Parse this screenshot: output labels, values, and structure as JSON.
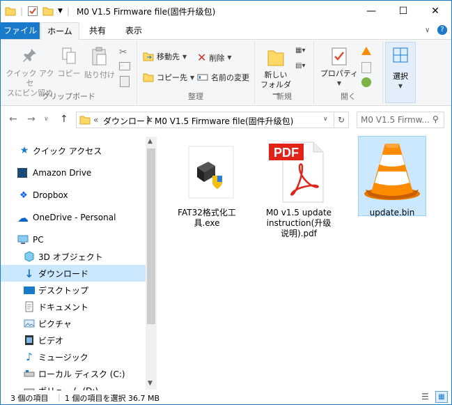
{
  "window": {
    "title": "M0 V1.5 Firmware file(固件升级包)"
  },
  "ribbon_tabs": [
    "ファイル",
    "ホーム",
    "共有",
    "表示"
  ],
  "ribbon": {
    "clipboard": {
      "pin_label": "クイック アクセ\nスにピン留め",
      "copy_label": "コピー",
      "paste_label": "貼り付け",
      "group_label": "クリップボード"
    },
    "organize": {
      "move_to": "移動先",
      "copy_to": "コピー先",
      "delete": "削除",
      "rename": "名前の変更",
      "group_label": "整理"
    },
    "new": {
      "new_folder": "新しい\nフォルダー",
      "group_label": "新規"
    },
    "open": {
      "properties": "プロパティ",
      "group_label": "開く"
    },
    "select": {
      "select": "選択"
    }
  },
  "address": {
    "overflow": "«",
    "crumbs": [
      "ダウンロード",
      "M0 V1.5 Firmware file(固件升级包)"
    ],
    "search_placeholder": "M0 V1.5 Firmw..."
  },
  "nav": [
    {
      "label": "クイック アクセス",
      "icon": "star-icon"
    },
    {
      "label": "Amazon Drive",
      "icon": "amazon-drive-icon"
    },
    {
      "label": "Dropbox",
      "icon": "dropbox-icon"
    },
    {
      "label": "OneDrive - Personal",
      "icon": "onedrive-icon"
    },
    {
      "label": "PC",
      "icon": "pc-icon"
    },
    {
      "label": "3D オブジェクト",
      "icon": "3d-objects-icon"
    },
    {
      "label": "ダウンロード",
      "icon": "download-icon",
      "selected": true
    },
    {
      "label": "デスクトップ",
      "icon": "desktop-icon"
    },
    {
      "label": "ドキュメント",
      "icon": "documents-icon"
    },
    {
      "label": "ピクチャ",
      "icon": "pictures-icon"
    },
    {
      "label": "ビデオ",
      "icon": "videos-icon"
    },
    {
      "label": "ミュージック",
      "icon": "music-icon"
    },
    {
      "label": "ローカル ディスク (C:)",
      "icon": "drive-icon"
    },
    {
      "label": "ボリューム (D:)",
      "icon": "drive-icon"
    }
  ],
  "files": [
    {
      "name": "FAT32格式化工具.exe",
      "icon": "exe-icon"
    },
    {
      "name": "M0 v1.5 update instruction(升级说明).pdf",
      "icon": "pdf-icon"
    },
    {
      "name": "update.bin",
      "icon": "vlc-cone-icon",
      "selected": true
    }
  ],
  "status": {
    "item_count": "3 個の項目",
    "selection": "1 個の項目を選択 36.7 MB"
  },
  "colors": {
    "accent": "#1979ca",
    "selection": "#cce8ff"
  }
}
